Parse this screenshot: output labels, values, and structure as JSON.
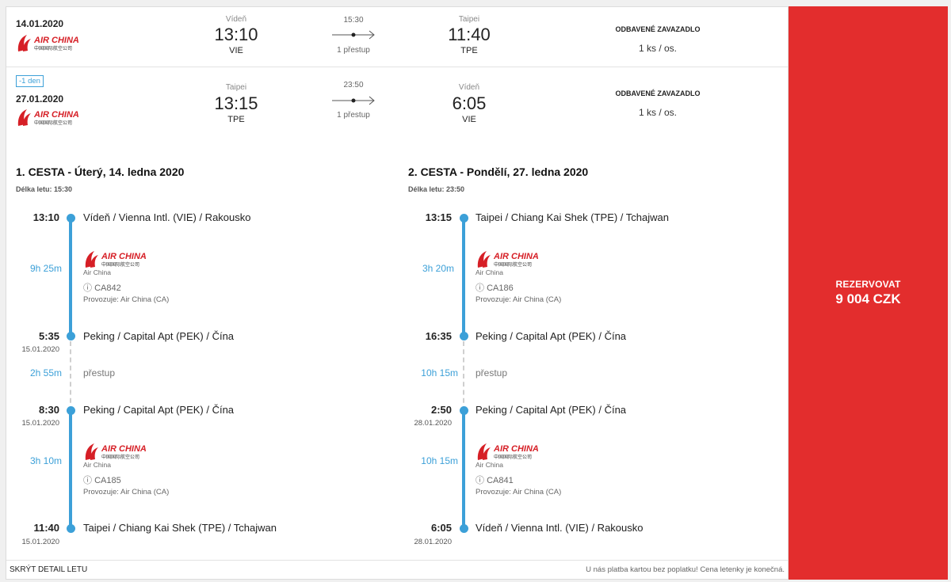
{
  "outbound": {
    "date": "14.01.2020",
    "dep_city": "Vídeň",
    "dep_time": "13:10",
    "dep_iata": "VIE",
    "duration": "15:30",
    "stops": "1 přestup",
    "arr_city": "Taipei",
    "arr_time": "11:40",
    "arr_iata": "TPE",
    "baggage_head": "ODBAVENÉ ZAVAZADLO",
    "baggage_value": "1 ks / os."
  },
  "inbound": {
    "badge": "-1 den",
    "date": "27.01.2020",
    "dep_city": "Taipei",
    "dep_time": "13:15",
    "dep_iata": "TPE",
    "duration": "23:50",
    "stops": "1 přestup",
    "arr_city": "Vídeň",
    "arr_time": "6:05",
    "arr_iata": "VIE",
    "baggage_head": "ODBAVENÉ ZAVAZADLO",
    "baggage_value": "1 ks / os."
  },
  "airline": {
    "logo_text": "AIR CHINA",
    "logo_sub": "中国国际航空公司",
    "name": "Air China",
    "operator": "Provozuje: Air China (CA)"
  },
  "trip1": {
    "title": "1. CESTA - Úterý, 14. ledna 2020",
    "length": "Délka letu: 15:30",
    "s1_time": "13:10",
    "s1_place": "Vídeň / Vienna Intl. (VIE) / Rakousko",
    "leg1_dur": "9h 25m",
    "leg1_flight": "CA842",
    "s2_time": "5:35",
    "s2_date": "15.01.2020",
    "s2_place": "Peking / Capital Apt (PEK) / Čína",
    "layover_dur": "2h 55m",
    "layover_label": "přestup",
    "s3_time": "8:30",
    "s3_date": "15.01.2020",
    "s3_place": "Peking / Capital Apt (PEK) / Čína",
    "leg2_dur": "3h 10m",
    "leg2_flight": "CA185",
    "s4_time": "11:40",
    "s4_date": "15.01.2020",
    "s4_place": "Taipei / Chiang Kai Shek (TPE) / Tchajwan"
  },
  "trip2": {
    "title": "2. CESTA - Pondělí, 27. ledna 2020",
    "length": "Délka letu: 23:50",
    "s1_time": "13:15",
    "s1_place": "Taipei / Chiang Kai Shek (TPE) / Tchajwan",
    "leg1_dur": "3h 20m",
    "leg1_flight": "CA186",
    "s2_time": "16:35",
    "s2_place": "Peking / Capital Apt (PEK) / Čína",
    "layover_dur": "10h 15m",
    "layover_label": "přestup",
    "s3_time": "2:50",
    "s3_date": "28.01.2020",
    "s3_place": "Peking / Capital Apt (PEK) / Čína",
    "leg2_dur": "10h 15m",
    "leg2_flight": "CA841",
    "s4_time": "6:05",
    "s4_date": "28.01.2020",
    "s4_place": "Vídeň / Vienna Intl. (VIE) / Rakousko"
  },
  "footer": {
    "hide_detail": "SKRÝT DETAIL LETU",
    "note": "U nás platba kartou bez poplatku! Cena letenky je konečná."
  },
  "cta": {
    "label": "REZERVOVAT",
    "price": "9 004 CZK"
  },
  "colors": {
    "accent": "#3ca0d8",
    "cta": "#e32d2d",
    "brand": "#d61f26"
  }
}
